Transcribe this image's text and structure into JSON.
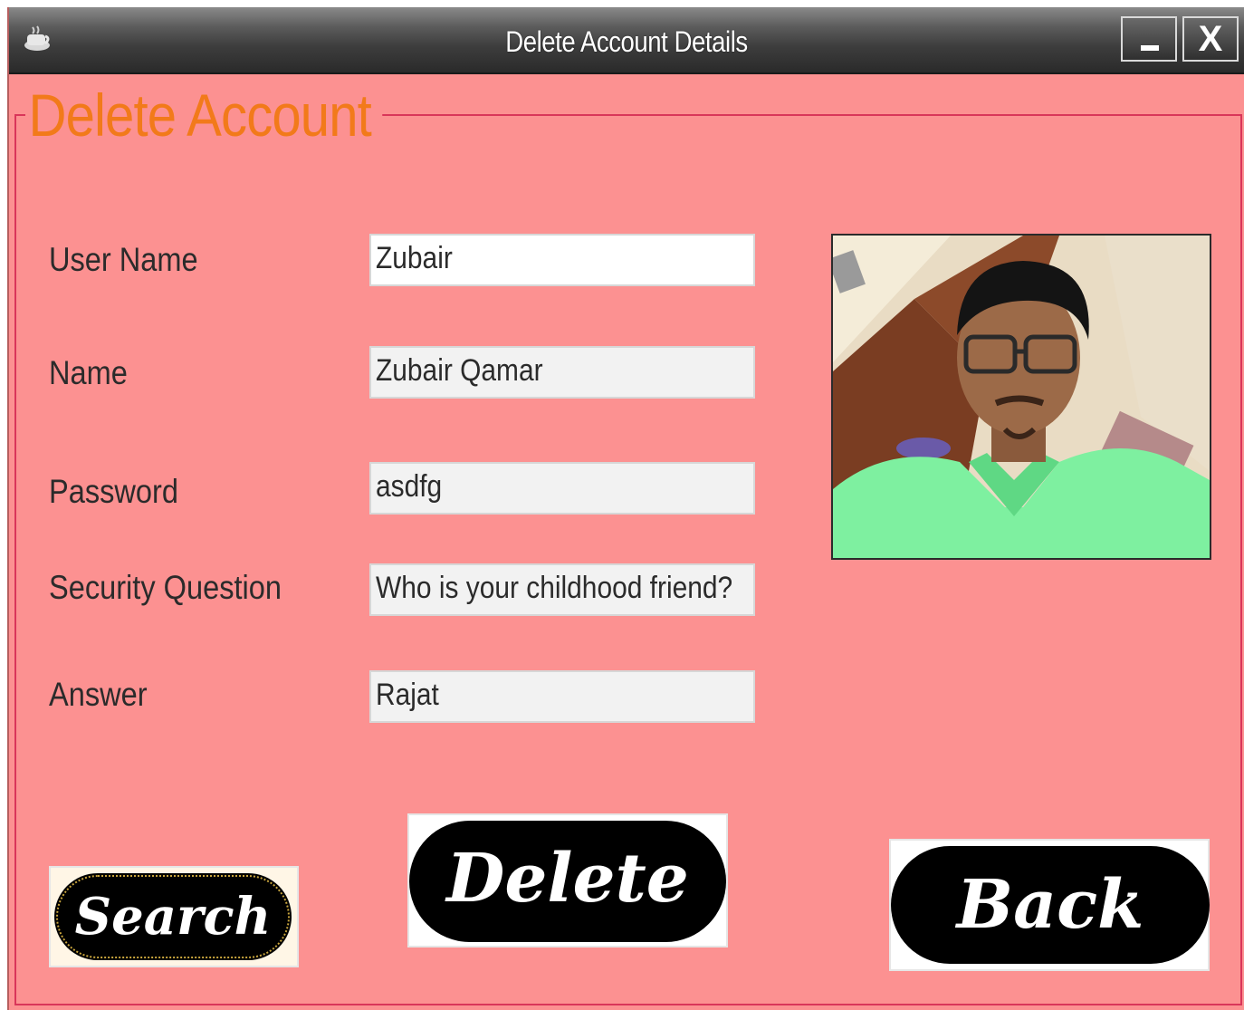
{
  "window": {
    "title": "Delete Account Details",
    "minimize_label": "",
    "close_label": "X"
  },
  "panel": {
    "title": "Delete Account"
  },
  "form": {
    "username": {
      "label": "User Name",
      "value": "Zubair"
    },
    "name": {
      "label": "Name",
      "value": "Zubair Qamar"
    },
    "password": {
      "label": "Password",
      "value": "asdfg"
    },
    "security_question": {
      "label": "Security Question",
      "value": "Who is your childhood friend?"
    },
    "answer": {
      "label": "Answer",
      "value": "Rajat"
    }
  },
  "buttons": {
    "search": "Search",
    "delete": "Delete",
    "back": "Back"
  },
  "colors": {
    "background": "#fc9191",
    "title_accent": "#f27a1a",
    "border_accent": "#d9365a",
    "button_fill": "#000000"
  }
}
